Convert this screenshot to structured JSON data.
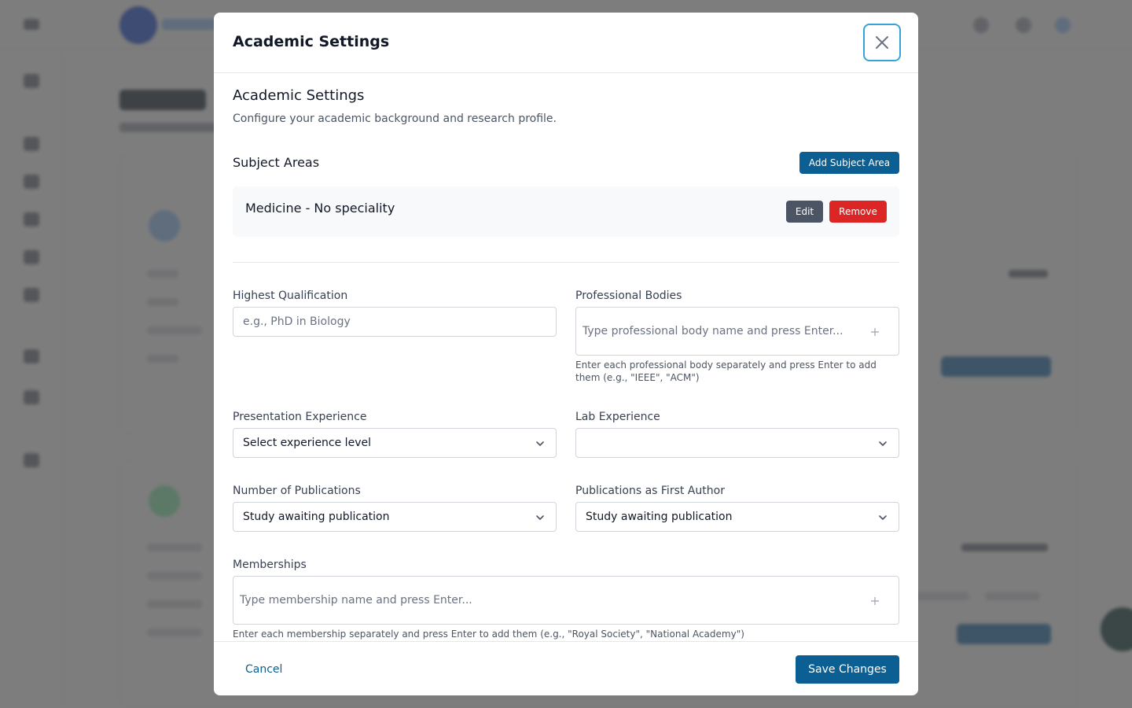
{
  "modal": {
    "title": "Academic Settings",
    "section_title": "Academic Settings",
    "section_description": "Configure your academic background and research profile.",
    "subject_areas": {
      "title": "Subject Areas",
      "add_label": "Add Subject Area",
      "items": [
        {
          "name": "Medicine - No speciality",
          "edit_label": "Edit",
          "remove_label": "Remove"
        }
      ]
    },
    "fields": {
      "highest_qualification": {
        "label": "Highest Qualification",
        "placeholder": "e.g., PhD in Biology",
        "value": ""
      },
      "professional_bodies": {
        "label": "Professional Bodies",
        "placeholder": "Type professional body name and press Enter...",
        "hint": "Enter each professional body separately and press Enter to add them (e.g., \"IEEE\", \"ACM\")"
      },
      "presentation_experience": {
        "label": "Presentation Experience",
        "value": "Select experience level"
      },
      "lab_experience": {
        "label": "Lab Experience",
        "value": ""
      },
      "number_of_publications": {
        "label": "Number of Publications",
        "value": "Study awaiting publication"
      },
      "publications_first_author": {
        "label": "Publications as First Author",
        "value": "Study awaiting publication"
      },
      "memberships": {
        "label": "Memberships",
        "placeholder": "Type membership name and press Enter...",
        "hint": "Enter each membership separately and press Enter to add them (e.g., \"Royal Society\", \"National Academy\")"
      }
    },
    "footer": {
      "cancel_label": "Cancel",
      "save_label": "Save Changes"
    }
  },
  "icons": {
    "close": "close-icon",
    "plus": "plus-icon",
    "chevron": "chevron-down-icon"
  },
  "colors": {
    "primary": "#0b5f92",
    "danger": "#dc2626",
    "secondary": "#4b5563",
    "focus_ring": "#38a3d8",
    "overlay": "#4b4b4b"
  }
}
